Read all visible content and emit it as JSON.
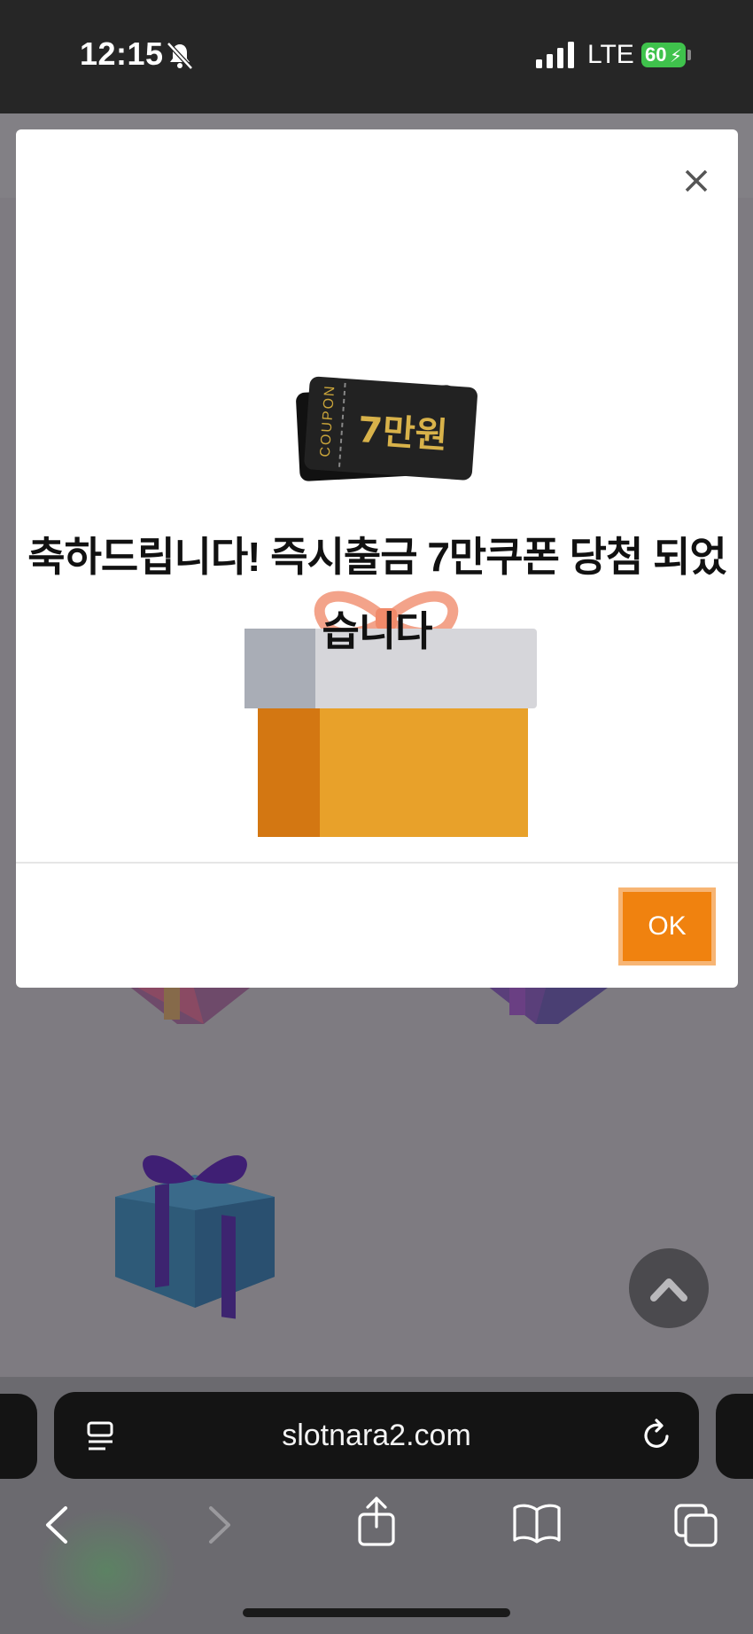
{
  "status_bar": {
    "time": "12:15",
    "network": "LTE",
    "battery": "60"
  },
  "modal": {
    "message": "축하드립니다! 즉시출금 7만쿠폰 당첨 되었습니다",
    "coupon_text": "COUPON",
    "coupon_amount": "7만원",
    "ok_label": "OK"
  },
  "browser": {
    "url": "slotnara2.com"
  },
  "colors": {
    "ok_button": "#f0820f",
    "overlay": "#7e7b81",
    "status_bar": "#262626"
  }
}
